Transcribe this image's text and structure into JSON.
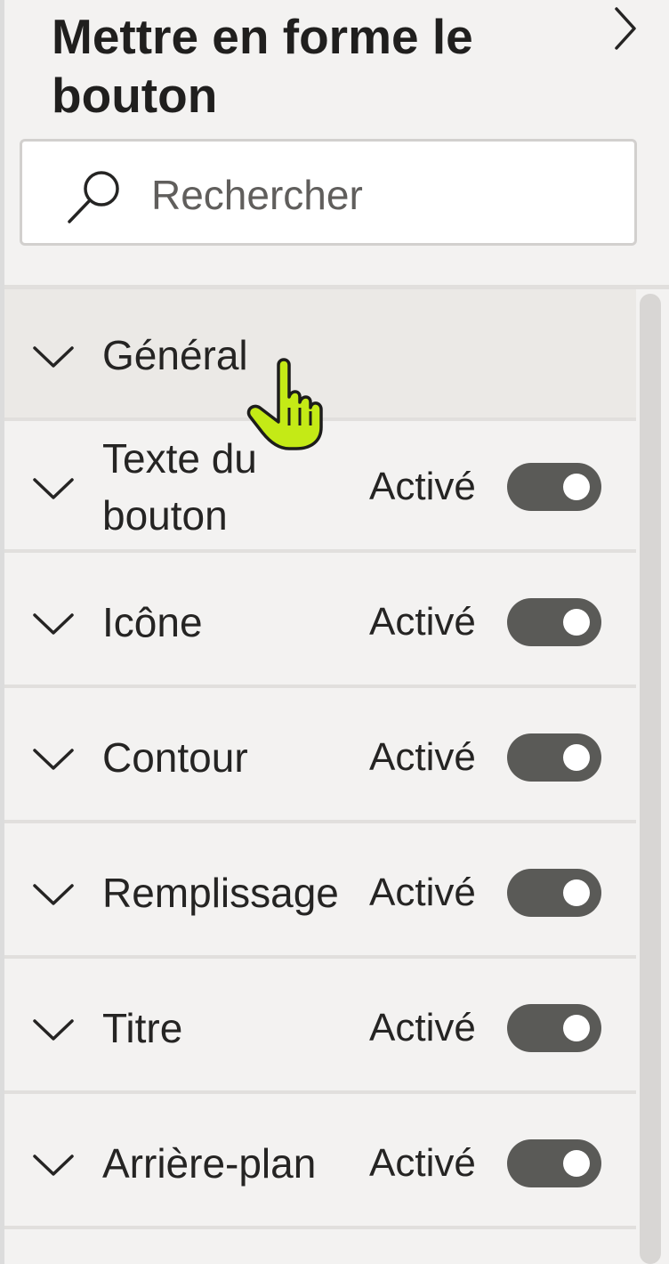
{
  "panel": {
    "title": "Mettre en forme le bouton",
    "expand_icon": "chevron-right-icon"
  },
  "search": {
    "placeholder": "Rechercher",
    "value": "",
    "icon": "search-icon"
  },
  "sections": [
    {
      "label": "Général",
      "state": "",
      "toggle_on": false,
      "has_toggle": false
    },
    {
      "label": "Texte du bouton",
      "state": "Activé",
      "toggle_on": true,
      "has_toggle": true
    },
    {
      "label": "Icône",
      "state": "Activé",
      "toggle_on": true,
      "has_toggle": true
    },
    {
      "label": "Contour",
      "state": "Activé",
      "toggle_on": true,
      "has_toggle": true
    },
    {
      "label": "Remplissage",
      "state": "Activé",
      "toggle_on": true,
      "has_toggle": true
    },
    {
      "label": "Titre",
      "state": "Activé",
      "toggle_on": true,
      "has_toggle": true
    },
    {
      "label": "Arrière-plan",
      "state": "Activé",
      "toggle_on": true,
      "has_toggle": true
    }
  ],
  "colors": {
    "panel_bg": "#f3f2f1",
    "toggle_on": "#5a5a57",
    "cursor_fill": "#c4ea16"
  }
}
